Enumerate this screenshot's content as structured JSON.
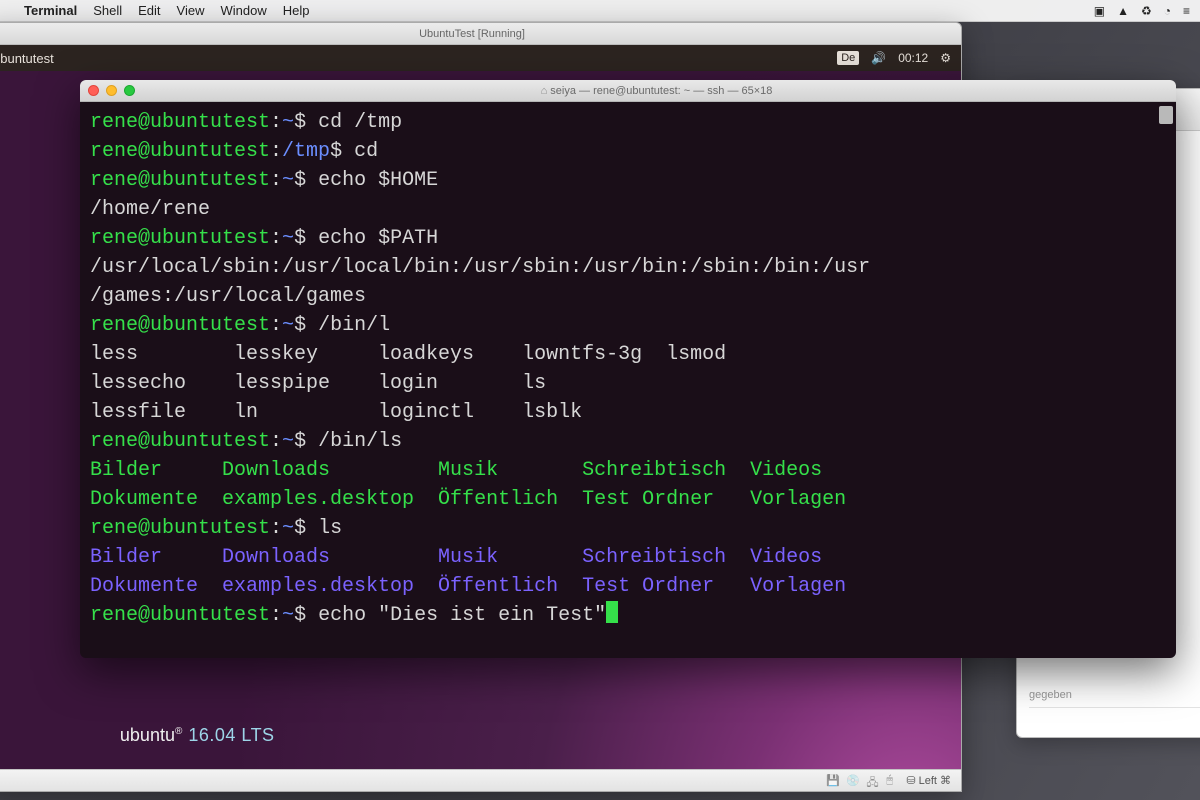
{
  "mac_menu": {
    "app": "Terminal",
    "items": [
      "Shell",
      "Edit",
      "View",
      "Window",
      "Help"
    ],
    "right_icons": [
      "▣",
      "▲",
      "♻",
      "◔",
      "≡"
    ]
  },
  "vbox": {
    "title": "UbuntuTest [Running]",
    "status_right": "⛁ Left ⌘"
  },
  "ubuntu": {
    "topbar_title": "ubuntutest",
    "lang": "De",
    "clock": "00:12",
    "brand": "ubuntu",
    "version": "16.04 LTS"
  },
  "side_window": {
    "line1": "gegeben"
  },
  "terminal": {
    "title": "seiya — rene@ubuntutest: ~ — ssh — 65×18",
    "prompt": {
      "user": "rene",
      "host": "ubuntutest"
    },
    "lines": [
      {
        "type": "cmd",
        "path": "~",
        "text": "cd /tmp"
      },
      {
        "type": "cmd",
        "path": "/tmp",
        "text": "cd"
      },
      {
        "type": "cmd",
        "path": "~",
        "text": "echo $HOME"
      },
      {
        "type": "out",
        "text": "/home/rene"
      },
      {
        "type": "cmd",
        "path": "~",
        "text": "echo $PATH"
      },
      {
        "type": "out",
        "text": "/usr/local/sbin:/usr/local/bin:/usr/sbin:/usr/bin:/sbin:/bin:/usr"
      },
      {
        "type": "out",
        "text": "/games:/usr/local/games"
      },
      {
        "type": "cmd",
        "path": "~",
        "text": "/bin/l"
      },
      {
        "type": "out",
        "text": "less        lesskey     loadkeys    lowntfs-3g  lsmod"
      },
      {
        "type": "out",
        "text": "lessecho    lesspipe    login       ls"
      },
      {
        "type": "out",
        "text": "lessfile    ln          loginctl    lsblk"
      },
      {
        "type": "cmd",
        "path": "~",
        "text": "/bin/ls"
      },
      {
        "type": "dirg",
        "text": "Bilder     Downloads         Musik       Schreibtisch  Videos"
      },
      {
        "type": "dirg",
        "text": "Dokumente  examples.desktop  Öffentlich  Test Ordner   Vorlagen"
      },
      {
        "type": "cmd",
        "path": "~",
        "text": "ls"
      },
      {
        "type": "dirb",
        "text": "Bilder     Downloads         Musik       Schreibtisch  Videos"
      },
      {
        "type": "dirb2",
        "text": "Dokumente  examples.desktop  Öffentlich  Test Ordner   Vorlagen"
      },
      {
        "type": "cmd",
        "path": "~",
        "text": "echo \"Dies ist ein Test\"",
        "cursor": true
      }
    ]
  }
}
